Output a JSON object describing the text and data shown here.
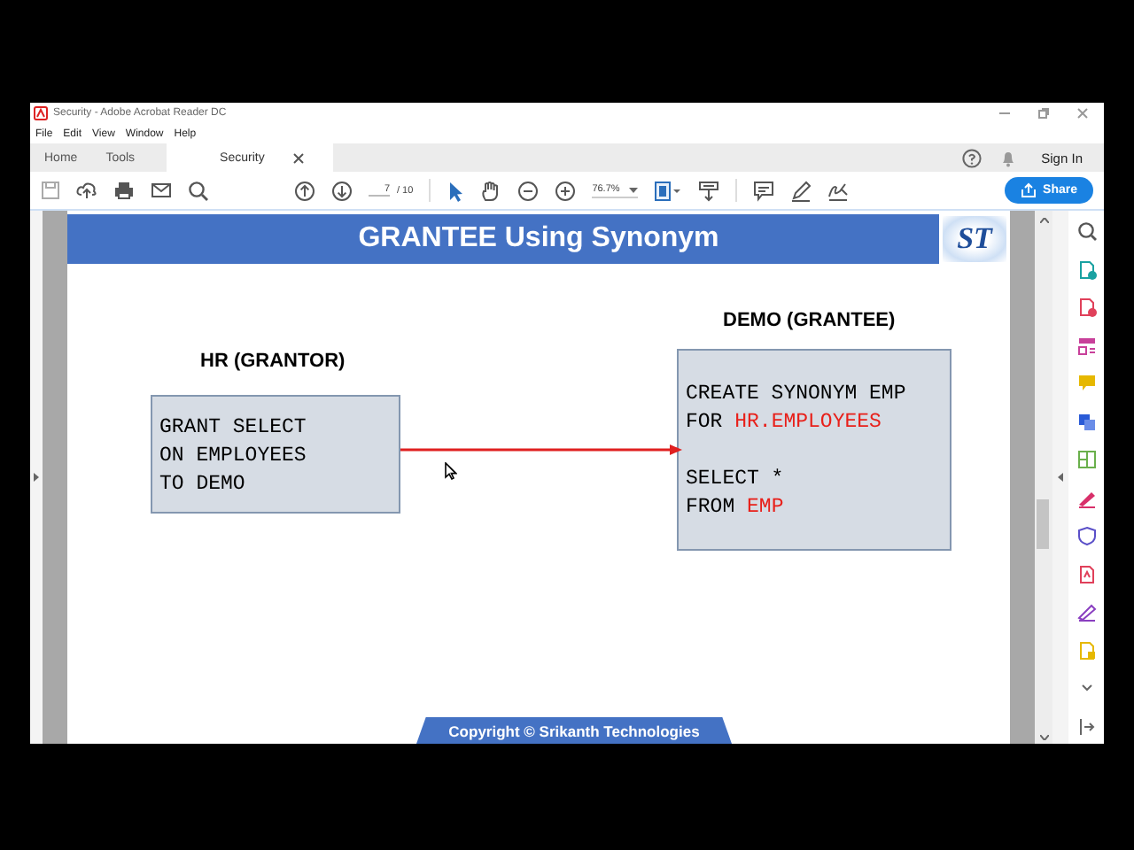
{
  "window": {
    "title": "Security - Adobe Acrobat Reader DC"
  },
  "menu": [
    "File",
    "Edit",
    "View",
    "Window",
    "Help"
  ],
  "tabs": [
    {
      "label": "Home",
      "selected": false
    },
    {
      "label": "Tools",
      "selected": false
    },
    {
      "label": "Security",
      "selected": true,
      "closable": true
    }
  ],
  "top_right": {
    "sign_in": "Sign In"
  },
  "toolbar": {
    "page": "7",
    "page_total": "/ 10",
    "zoom": "76.7%",
    "share": "Share"
  },
  "slide": {
    "title": "GRANTEE Using Synonym",
    "logo": "ST",
    "left": {
      "label": "HR (GRANTOR)",
      "lines": [
        [
          {
            "text": "GRANT SELECT"
          }
        ],
        [
          {
            "text": "ON EMPLOYEES"
          }
        ],
        [
          {
            "text": "TO DEMO"
          }
        ]
      ]
    },
    "right": {
      "label": "DEMO (GRANTEE)",
      "lines": [
        [
          {
            "text": "CREATE SYNONYM EMP"
          }
        ],
        [
          {
            "text": "FOR "
          },
          {
            "text": "HR.EMPLOYEES",
            "highlight": true
          }
        ],
        [
          {
            "text": "SELECT *",
            "gap_before": true
          }
        ],
        [
          {
            "text": "FROM "
          },
          {
            "text": "EMP",
            "highlight": true
          }
        ]
      ]
    },
    "footer": "Copyright © Srikanth Technologies"
  }
}
